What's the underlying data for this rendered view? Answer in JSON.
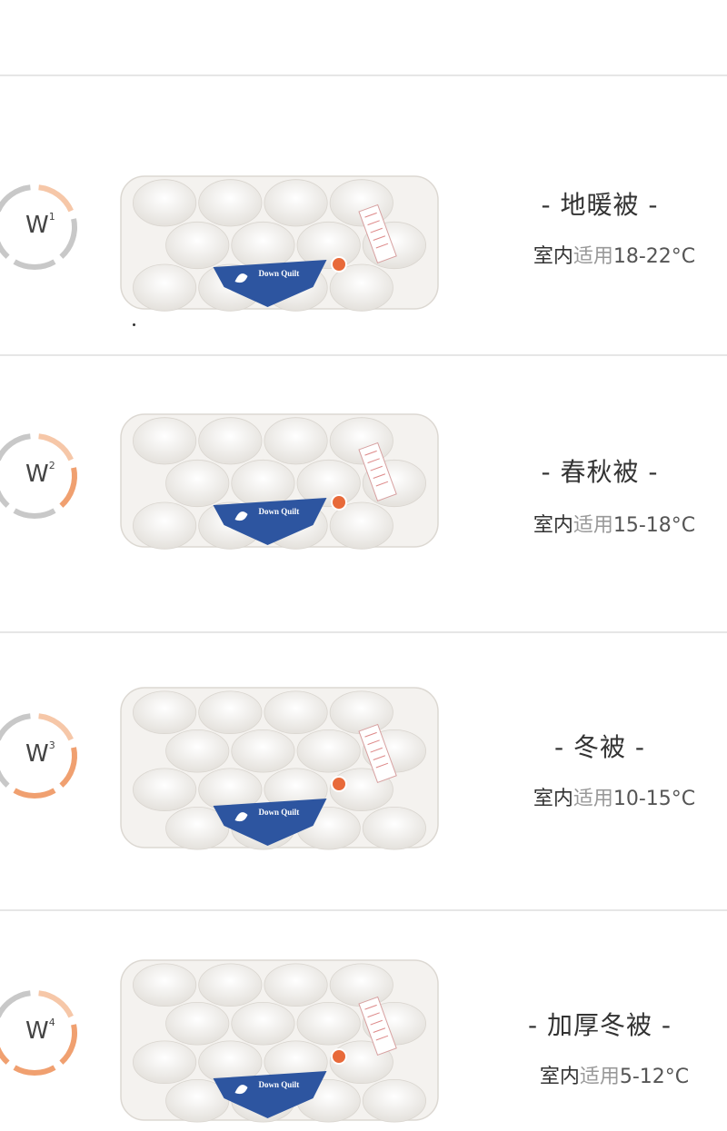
{
  "items": [
    {
      "badge": {
        "letter": "W",
        "sup": "1"
      },
      "level": 0.25,
      "title": "- 地暖被 -",
      "temp_prefix": "室内",
      "temp_mid": "适用",
      "temp_range": "18-22°C",
      "tag_text": "Down Quilt"
    },
    {
      "badge": {
        "letter": "W",
        "sup": "2"
      },
      "level": 0.5,
      "title": "- 春秋被 -",
      "temp_prefix": "室内",
      "temp_mid": "适用",
      "temp_range": "15-18°C",
      "tag_text": "Down Quilt"
    },
    {
      "badge": {
        "letter": "W",
        "sup": "3"
      },
      "level": 0.75,
      "title": "- 冬被 -",
      "temp_prefix": "室内",
      "temp_mid": "适用",
      "temp_range": "10-15°C",
      "tag_text": "Down Quilt"
    },
    {
      "badge": {
        "letter": "W",
        "sup": "4"
      },
      "level": 1.0,
      "title": "- 加厚冬被 -",
      "temp_prefix": "室内",
      "temp_mid": "适用",
      "temp_range": "5-12°C",
      "tag_text": "Down Quilt"
    }
  ],
  "colors": {
    "gauge_active": "#f0a070",
    "gauge_inactive": "#c8c8c8",
    "tag_blue": "#2d55a0",
    "quilt_white": "#f4f2ef"
  }
}
